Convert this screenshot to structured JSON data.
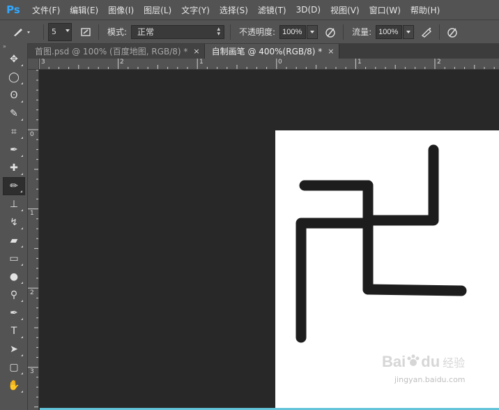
{
  "app": {
    "logo": "Ps"
  },
  "menu": [
    "文件(F)",
    "编辑(E)",
    "图像(I)",
    "图层(L)",
    "文字(Y)",
    "选择(S)",
    "滤镜(T)",
    "3D(D)",
    "视图(V)",
    "窗口(W)",
    "帮助(H)"
  ],
  "options": {
    "brush_size": "5",
    "mode_label": "模式:",
    "mode_value": "正常",
    "opacity_label": "不透明度:",
    "opacity_value": "100%",
    "flow_label": "流量:",
    "flow_value": "100%"
  },
  "tabs": [
    {
      "label": "首图.psd @ 100% (百度地图, RGB/8) *",
      "close": "×",
      "active": false
    },
    {
      "label": "自制画笔 @ 400%(RGB/8) *",
      "close": "×",
      "active": true
    }
  ],
  "ruler": {
    "top_labels": [
      "3",
      "2",
      "1",
      "0",
      "1",
      "2"
    ],
    "left_labels": [
      "0",
      "1",
      "2",
      "3"
    ]
  },
  "toolbox": {
    "grip": "»",
    "tools": [
      {
        "name": "move-tool-icon",
        "glyph": "✥"
      },
      {
        "name": "marquee-tool-icon",
        "glyph": "◯"
      },
      {
        "name": "lasso-tool-icon",
        "glyph": "ʘ"
      },
      {
        "name": "quick-select-tool-icon",
        "glyph": "✎"
      },
      {
        "name": "crop-tool-icon",
        "glyph": "⌗"
      },
      {
        "name": "eyedropper-tool-icon",
        "glyph": "✒"
      },
      {
        "name": "healing-brush-tool-icon",
        "glyph": "✚"
      },
      {
        "name": "brush-tool-icon",
        "glyph": "✏",
        "active": true
      },
      {
        "name": "clone-stamp-tool-icon",
        "glyph": "⊥"
      },
      {
        "name": "history-brush-tool-icon",
        "glyph": "↯"
      },
      {
        "name": "eraser-tool-icon",
        "glyph": "▰"
      },
      {
        "name": "gradient-tool-icon",
        "glyph": "▭"
      },
      {
        "name": "blur-tool-icon",
        "glyph": "●"
      },
      {
        "name": "dodge-tool-icon",
        "glyph": "⚲"
      },
      {
        "name": "pen-tool-icon",
        "glyph": "✒"
      },
      {
        "name": "type-tool-icon",
        "glyph": "T"
      },
      {
        "name": "path-select-tool-icon",
        "glyph": "➤"
      },
      {
        "name": "shape-tool-icon",
        "glyph": "▢"
      },
      {
        "name": "hand-tool-icon",
        "glyph": "✋"
      }
    ]
  },
  "watermark": {
    "brand": "Bai",
    "brand2": "du",
    "sub": "经验",
    "url": "jingyan.baidu.com"
  },
  "colors": {
    "accent": "#31a8ff",
    "panel": "#535353",
    "workspace": "#282828",
    "canvas": "#ffffff",
    "stroke": "#000000"
  }
}
